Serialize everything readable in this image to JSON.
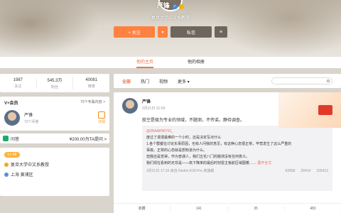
{
  "profile": {
    "name": "严锋",
    "subtitle": "复旦大学中文系教授",
    "follow_label": "+ 关注",
    "message_label": "私信",
    "menu_icon": "list-icon",
    "dropdown_icon": "chevron-down-icon"
  },
  "tabs": [
    "他的主页",
    "他的相册"
  ],
  "stats": [
    {
      "num": "1987",
      "label": "关注"
    },
    {
      "num": "545.3万",
      "label": "粉丝"
    },
    {
      "num": "40081",
      "label": "微博"
    }
  ],
  "vip": {
    "title": "V+会员",
    "more": "72个专属内容 >",
    "name": "严锋",
    "sub": "72个问答",
    "subscribe": "订阅"
  },
  "qa": {
    "label": "问答",
    "price": "¥200.00为TA提问 >"
  },
  "bio": {
    "level": "Lv 48",
    "org": "复旦大学中文系教授",
    "location": "上海 黄浦区"
  },
  "feed": {
    "tabs": [
      "全部",
      "热门",
      "视频",
      "更多 ▾"
    ],
    "active_tab": 0
  },
  "post": {
    "name": "严锋",
    "time": "3月21日 21:09",
    "text": "航空是极为专业的领域，不臆测，不传谣，静待调查。",
    "repost_user": "@ZBAARWY01_",
    "repost_lines": [
      "度过了漫漫最难的一个小时，还是决定写点什么",
      "1.各个群都在讨论东事原因，也有人问我的意见，有这种心态很正常，毕竟发生了这么严重的",
      "事故。正常的心态就是想知道为什么。",
      "但我还是觉得，作为普通人，我们五花八门的臆测没有任何意义。",
      "我们现在看到的无非是——高下降率的最后时刻雷主板航区域图着……"
    ],
    "fulltext": "展开全文",
    "repost_time": "3月21日 17:16 来自 Redmi K30 Pro 真旗舰",
    "repost_share": "62858",
    "repost_comment": "28414",
    "repost_like": "155412",
    "actions": {
      "collect": "收藏",
      "share": "141",
      "comment": "35",
      "like": "483"
    }
  },
  "colors": {
    "accent": "#eb7350",
    "follow": "#ff8140",
    "message": "#6e665c"
  }
}
